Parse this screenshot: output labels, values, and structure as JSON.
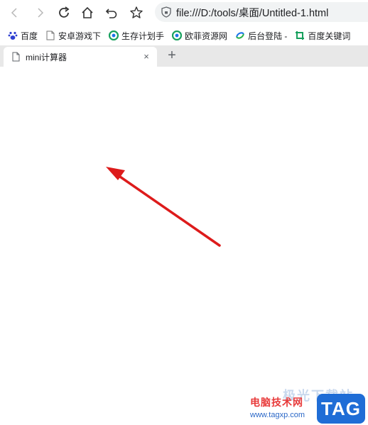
{
  "toolbar": {
    "back_icon": "chevron-left-icon",
    "forward_icon": "chevron-right-icon",
    "reload_icon": "reload-icon",
    "home_icon": "home-icon",
    "undo_icon": "undo-icon",
    "star_icon": "star-icon"
  },
  "address": {
    "url": "file:///D:/tools/桌面/Untitled-1.html"
  },
  "bookmarks": [
    {
      "label": "百度",
      "icon": "baidu-paw-icon"
    },
    {
      "label": "安卓游戏下",
      "icon": "page-icon"
    },
    {
      "label": "生存计划手",
      "icon": "circle-logo-icon"
    },
    {
      "label": "欧菲资源网",
      "icon": "circle-logo-icon"
    },
    {
      "label": "后台登陆 -",
      "icon": "swirl-logo-icon"
    },
    {
      "label": "百度关键词",
      "icon": "crop-icon"
    }
  ],
  "tabs": [
    {
      "title": "mini计算器",
      "close": "×"
    }
  ],
  "newtab_label": "+",
  "watermark": {
    "text": "电脑技术网",
    "url": "www.tagxp.com",
    "faint": "极光下载站",
    "badge": "TAG"
  },
  "colors": {
    "arrow": "#dd1b1b",
    "tabstrip": "#e8e8e8",
    "badge": "#1f6dd6",
    "watermark_text": "#e83a3a"
  }
}
